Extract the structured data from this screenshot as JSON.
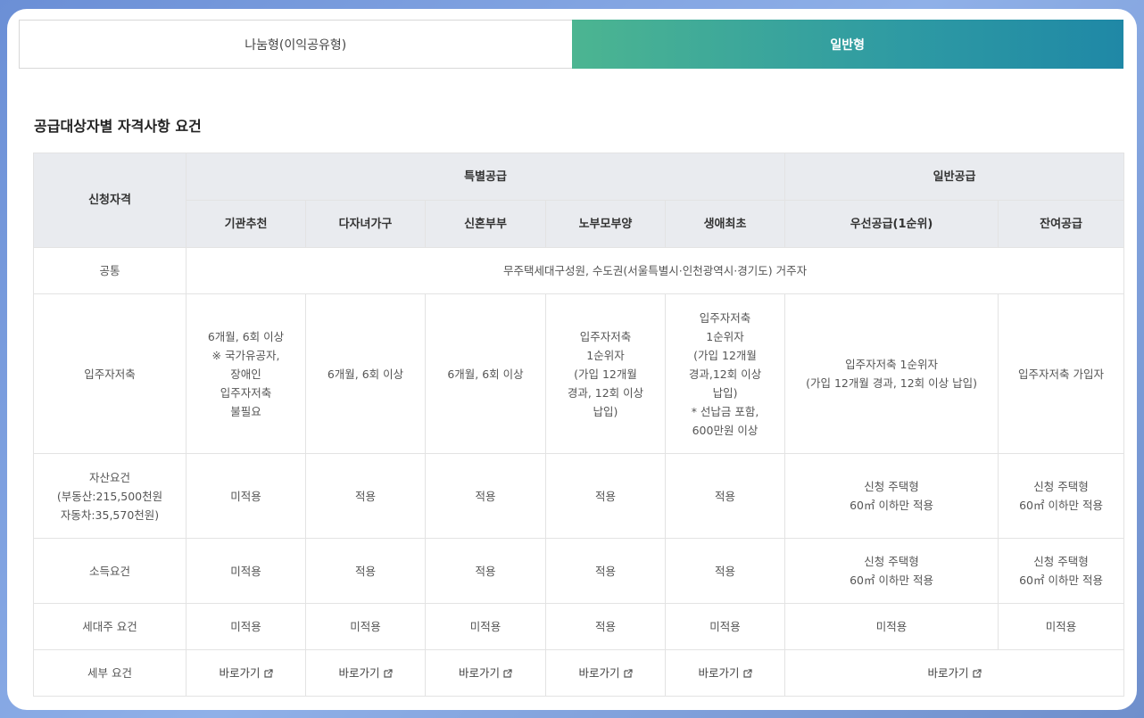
{
  "tabs": [
    {
      "label": "나눔형(이익공유형)",
      "active": false
    },
    {
      "label": "일반형",
      "active": true
    }
  ],
  "section_title": "공급대상자별 자격사항 요건",
  "table": {
    "col_qualification": "신청자격",
    "group_special": "특별공급",
    "group_general": "일반공급",
    "columns": [
      "기관추천",
      "다자녀가구",
      "신혼부부",
      "노부모부양",
      "생애최초",
      "우선공급(1순위)",
      "잔여공급"
    ],
    "rows": {
      "common": {
        "label": "공통",
        "value": "무주택세대구성원, 수도권(서울특별시·인천광역시·경기도) 거주자"
      },
      "savings": {
        "label": "입주자저축",
        "cells": [
          "6개월, 6회 이상\n※ 국가유공자,\n장애인\n입주자저축\n불필요",
          "6개월, 6회 이상",
          "6개월, 6회 이상",
          "입주자저축\n1순위자\n(가입 12개월\n경과, 12회 이상\n납입)",
          "입주자저축\n1순위자\n(가입 12개월\n경과,12회 이상\n납입)\n* 선납금 포함,\n600만원 이상",
          "입주자저축 1순위자\n(가입 12개월 경과, 12회 이상 납입)",
          "입주자저축 가입자"
        ]
      },
      "asset": {
        "label": "자산요건\n(부동산:215,500천원\n자동차:35,570천원)",
        "cells": [
          "미적용",
          "적용",
          "적용",
          "적용",
          "적용",
          "신청 주택형\n60㎡ 이하만 적용",
          "신청 주택형\n60㎡ 이하만 적용"
        ]
      },
      "income": {
        "label": "소득요건",
        "cells": [
          "미적용",
          "적용",
          "적용",
          "적용",
          "적용",
          "신청 주택형\n60㎡ 이하만 적용",
          "신청 주택형\n60㎡ 이하만 적용"
        ]
      },
      "householder": {
        "label": "세대주 요건",
        "cells": [
          "미적용",
          "미적용",
          "미적용",
          "적용",
          "미적용",
          "미적용",
          "미적용"
        ]
      },
      "detail": {
        "label": "세부 요건",
        "link_label": "바로가기"
      }
    }
  }
}
